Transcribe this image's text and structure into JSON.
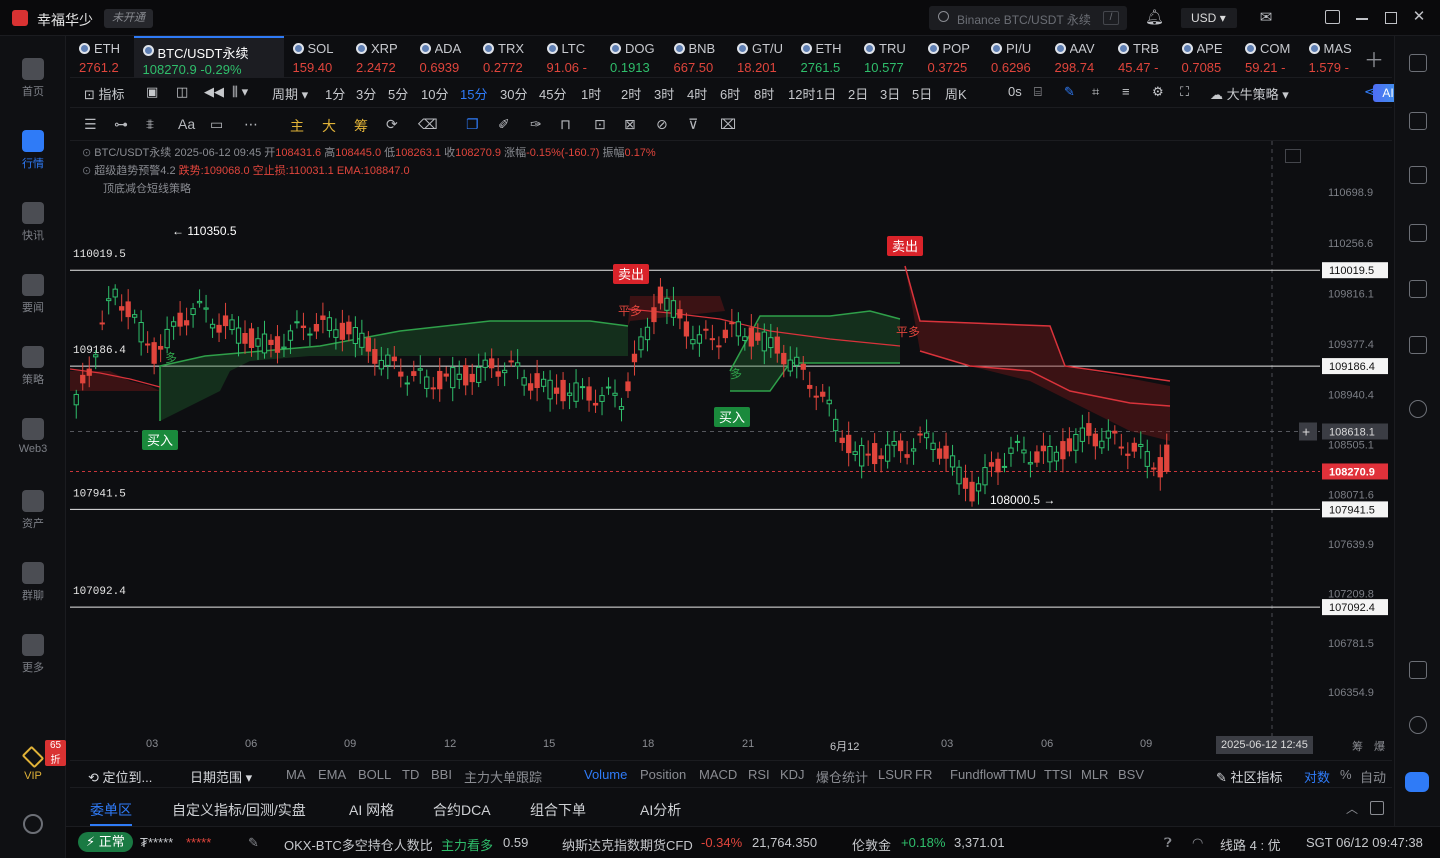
{
  "app": {
    "name": "幸福华少",
    "account_status": "未开通"
  },
  "search": {
    "placeholder": "Binance BTC/USDT 永续",
    "shortcut": "/"
  },
  "currency": "USD",
  "nav": [
    {
      "label": "首页",
      "icon": "home-icon"
    },
    {
      "label": "行情",
      "icon": "market-chart-icon",
      "active": true
    },
    {
      "label": "快讯",
      "icon": "newsflash-icon"
    },
    {
      "label": "要闻",
      "icon": "headline-news-icon"
    },
    {
      "label": "策略",
      "icon": "strategy-robot-icon"
    },
    {
      "label": "Web3",
      "icon": "web3-icon"
    },
    {
      "label": "资产",
      "icon": "wallet-icon"
    },
    {
      "label": "群聊",
      "icon": "group-chat-icon"
    },
    {
      "label": "更多",
      "icon": "more-grid-icon"
    }
  ],
  "vip": {
    "label": "VIP",
    "badge": "65折"
  },
  "tickers": [
    {
      "name": "ETH",
      "price": "2761.2",
      "dir": "down"
    },
    {
      "name": "BTC/USDT永续",
      "price": "108270.9  -0.29%",
      "dir": "up",
      "active": true
    },
    {
      "name": "SOL",
      "price": "159.40",
      "dir": "down"
    },
    {
      "name": "XRP",
      "price": "2.2472",
      "dir": "down"
    },
    {
      "name": "ADA",
      "price": "0.6939",
      "dir": "down"
    },
    {
      "name": "TRX",
      "price": "0.2772",
      "dir": "down"
    },
    {
      "name": "LTC",
      "price": "91.06 -",
      "dir": "down"
    },
    {
      "name": "DOG",
      "price": "0.1913",
      "dir": "up"
    },
    {
      "name": "BNB",
      "price": "667.50",
      "dir": "down"
    },
    {
      "name": "GT/U",
      "price": "18.201",
      "dir": "down"
    },
    {
      "name": "ETH",
      "price": "2761.5",
      "dir": "up"
    },
    {
      "name": "TRU",
      "price": "10.577",
      "dir": "up"
    },
    {
      "name": "POP",
      "price": "0.3725",
      "dir": "down"
    },
    {
      "name": "PI/U",
      "price": "0.6296",
      "dir": "down"
    },
    {
      "name": "AAV",
      "price": "298.74",
      "dir": "down"
    },
    {
      "name": "TRB",
      "price": "45.47 -",
      "dir": "down"
    },
    {
      "name": "APE",
      "price": "0.7085",
      "dir": "down"
    },
    {
      "name": "COM",
      "price": "59.21 -",
      "dir": "down"
    },
    {
      "name": "MAS",
      "price": "1.579 -",
      "dir": "down"
    }
  ],
  "toolbar": {
    "indicator": "指标",
    "period": "周期",
    "intervals": [
      "1分",
      "3分",
      "5分",
      "10分",
      "15分",
      "30分",
      "45分",
      "1时",
      "2时",
      "3时",
      "4时",
      "6时",
      "8时",
      "12时",
      "1日",
      "2日",
      "3日",
      "5日",
      "周K"
    ],
    "selected_interval": "15分",
    "countdown": "0s",
    "strategy": "大牛策略",
    "ai": "AI解读"
  },
  "drawtools": {
    "main": "主",
    "big": "大",
    "chip": "筹",
    "font": "Aa"
  },
  "chart_info": {
    "symbol": "BTC/USDT永续",
    "datetime": "2025-06-12 09:45",
    "open_label": "开",
    "open": "108431.6",
    "high_label": "高",
    "high": "108445.0",
    "low_label": "低",
    "low": "108263.1",
    "close_label": "收",
    "close": "108270.9",
    "change_label": "涨幅",
    "change": "-0.15%(-160.7)",
    "amp_label": "振幅",
    "amplitude": "0.17%",
    "indicator_name": "超级趋势预警4.2",
    "trend": "跌势:109068.0",
    "short_stop": "空止损:110031.1",
    "ema": "EMA:108847.0",
    "strategy_name": "顶底减仓短线策略"
  },
  "chart_data": {
    "type": "candlestick",
    "symbol": "BTC/USDT永续",
    "interval": "15分",
    "ylim": [
      106200,
      111000
    ],
    "y_ticks": [
      "110698.9",
      "110256.6",
      "109816.1",
      "109377.4",
      "108940.4",
      "108505.1",
      "108071.6",
      "107639.9",
      "107209.8",
      "106781.5",
      "106354.9"
    ],
    "x_ticks": [
      "03",
      "06",
      "09",
      "12",
      "15",
      "18",
      "21",
      "6月12",
      "03",
      "06",
      "09"
    ],
    "horizontal_levels": [
      "110019.5",
      "109186.4",
      "107941.5",
      "107092.4"
    ],
    "crosshair_price": "108618.1",
    "last_price": "108270.9",
    "crosshair_time": "2025-06-12 12:45",
    "high_mark": "110350.5",
    "low_mark": "108000.5",
    "signals": [
      {
        "label": "买入",
        "type": "buy",
        "time": "02:00"
      },
      {
        "label": "卖出",
        "type": "sell",
        "time": "17:00"
      },
      {
        "label": "平多",
        "type": "close-long",
        "time": "17:00"
      },
      {
        "label": "买入",
        "type": "buy",
        "time": "23:30"
      },
      {
        "label": "卖出",
        "type": "sell",
        "time": "6月12 01:45"
      },
      {
        "label": "平多",
        "type": "close-long",
        "time": "6月12 01:45"
      },
      {
        "label": "多",
        "type": "long",
        "time": "02:30"
      },
      {
        "label": "多",
        "type": "long",
        "time": "23:30"
      }
    ],
    "ohlc_approx": [
      [
        109000,
        109100,
        108600,
        108850
      ],
      [
        108850,
        110350,
        108800,
        109850
      ],
      [
        109850,
        109950,
        109100,
        109300
      ],
      [
        109300,
        109900,
        109200,
        109700
      ],
      [
        109700,
        109800,
        109400,
        109500
      ],
      [
        109500,
        109650,
        109300,
        109350
      ],
      [
        109350,
        109650,
        109250,
        109550
      ],
      [
        109550,
        109700,
        109450,
        109500
      ],
      [
        109500,
        109550,
        109100,
        109200
      ],
      [
        109200,
        109300,
        108900,
        109050
      ],
      [
        109050,
        109250,
        108950,
        109100
      ],
      [
        109100,
        109300,
        109000,
        109200
      ],
      [
        109200,
        109300,
        108900,
        109000
      ],
      [
        109000,
        109150,
        108850,
        108950
      ],
      [
        108950,
        109100,
        108800,
        108900
      ],
      [
        108900,
        110200,
        108700,
        109800
      ],
      [
        109800,
        109900,
        109300,
        109400
      ],
      [
        109400,
        109600,
        109200,
        109500
      ],
      [
        109500,
        109700,
        109300,
        109350
      ],
      [
        109350,
        109450,
        108950,
        109000
      ],
      [
        109000,
        109100,
        108300,
        108400
      ],
      [
        108400,
        108600,
        108200,
        108450
      ],
      [
        108450,
        108700,
        108300,
        108550
      ],
      [
        108550,
        108600,
        108000,
        108100
      ],
      [
        108100,
        108500,
        108000,
        108450
      ],
      [
        108450,
        108550,
        108300,
        108400
      ],
      [
        108400,
        108650,
        108300,
        108600
      ],
      [
        108600,
        108650,
        108350,
        108500
      ],
      [
        108500,
        108600,
        108250,
        108270.9
      ]
    ]
  },
  "xaxis_right": {
    "a": "筹",
    "b": "爆"
  },
  "indicator_bar": {
    "locate": "定位到...",
    "range": "日期范围",
    "items": [
      "MA",
      "EMA",
      "BOLL",
      "TD",
      "BBI",
      "主力大单跟踪"
    ],
    "sub_items": [
      "Volume",
      "Position",
      "MACD",
      "RSI",
      "KDJ",
      "爆仓统计",
      "LSUR",
      "FR",
      "Fundflow",
      "TTMU",
      "TTSI",
      "MLR",
      "BSV"
    ],
    "selected": "Volume",
    "community": "社区指标",
    "log": "对数",
    "pct": "%",
    "auto": "自动"
  },
  "bottom_tabs": [
    "委单区",
    "自定义指标/回测/实盘",
    "AI 网格",
    "合约DCA",
    "组合下单",
    "AI分析"
  ],
  "status": {
    "state": "正常",
    "masked_acct": "₮*****",
    "masked_val": "*****",
    "okx_label": "OKX-BTC多空持仓人数比",
    "okx_sentiment": "主力看多",
    "okx_value": "0.59",
    "nasdaq_label": "纳斯达克指数期货CFD",
    "nasdaq_change": "-0.34%",
    "nasdaq_value": "21,764.350",
    "gold_label": "伦敦金",
    "gold_change": "+0.18%",
    "gold_value": "3,371.01",
    "line_label": "线路 4 : 优",
    "clock": "SGT  06/12 09:47:38"
  }
}
